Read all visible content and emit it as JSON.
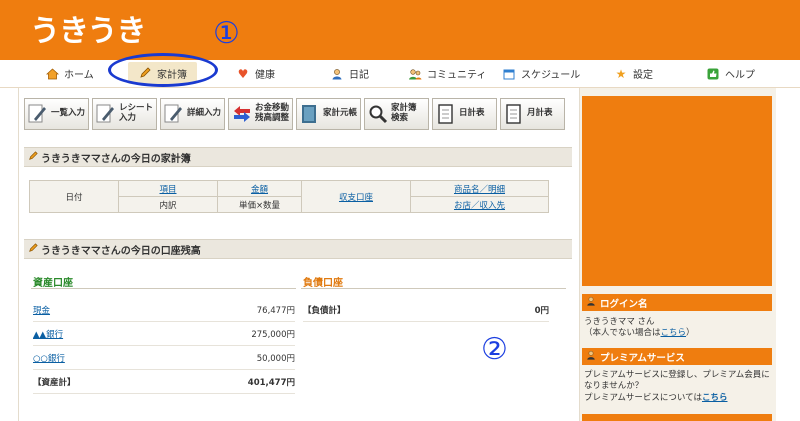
{
  "header": {
    "logo": "うきうき"
  },
  "nav": {
    "items": [
      {
        "label": "ホーム",
        "icon": "home-icon"
      },
      {
        "label": "家計簿",
        "icon": "pencil-icon"
      },
      {
        "label": "健康",
        "icon": "heart-icon"
      },
      {
        "label": "日記",
        "icon": "person-icon"
      },
      {
        "label": "コミュニティ",
        "icon": "people-icon"
      },
      {
        "label": "スケジュール",
        "icon": "calendar-icon"
      },
      {
        "label": "設定",
        "icon": "star-icon"
      },
      {
        "label": "ヘルプ",
        "icon": "thumb-icon"
      }
    ],
    "active_index": 1
  },
  "annotations": {
    "one": "①",
    "two": "②"
  },
  "toolbar": {
    "buttons": [
      {
        "label": "一覧入力"
      },
      {
        "label": "レシート入力"
      },
      {
        "label": "詳細入力"
      },
      {
        "label": "お金移動 残高調整"
      },
      {
        "label": "家計元帳"
      },
      {
        "label": "家計簿 検索"
      },
      {
        "label": "日計表"
      },
      {
        "label": "月計表"
      }
    ]
  },
  "today_section": {
    "title": "うきうきママさんの今日の家計簿",
    "headers": {
      "date": "日付",
      "item": "項目",
      "amount": "金額",
      "account": "収支口座",
      "product": "商品名／明細",
      "detail": "内訳",
      "unit": "単価×数量",
      "shop": "お店／収入先"
    }
  },
  "balance_section": {
    "title": "うきうきママさんの今日の口座残高",
    "assets_title": "資産口座",
    "debts_title": "負債口座",
    "assets": [
      {
        "name": "現金",
        "value": "76,477円"
      },
      {
        "name": "▲▲銀行",
        "value": "275,000円"
      },
      {
        "name": "○○銀行",
        "value": "50,000円"
      }
    ],
    "assets_total": {
      "name": "【資産計】",
      "value": "401,477円"
    },
    "debts_total": {
      "name": "【負債計】",
      "value": "0円"
    }
  },
  "sidebar": {
    "login_title": "ログイン名",
    "login_name": "うきうきママ さん",
    "login_note_pre": "（本人でない場合は",
    "login_note_link": "こちら",
    "login_note_post": "）",
    "premium_title": "プレミアムサービス",
    "premium_text": "プレミアムサービスに登録し、プレミアム会員になりませんか？",
    "premium_more_pre": "プレミアムサービスについては",
    "premium_more_link": "こちら"
  }
}
